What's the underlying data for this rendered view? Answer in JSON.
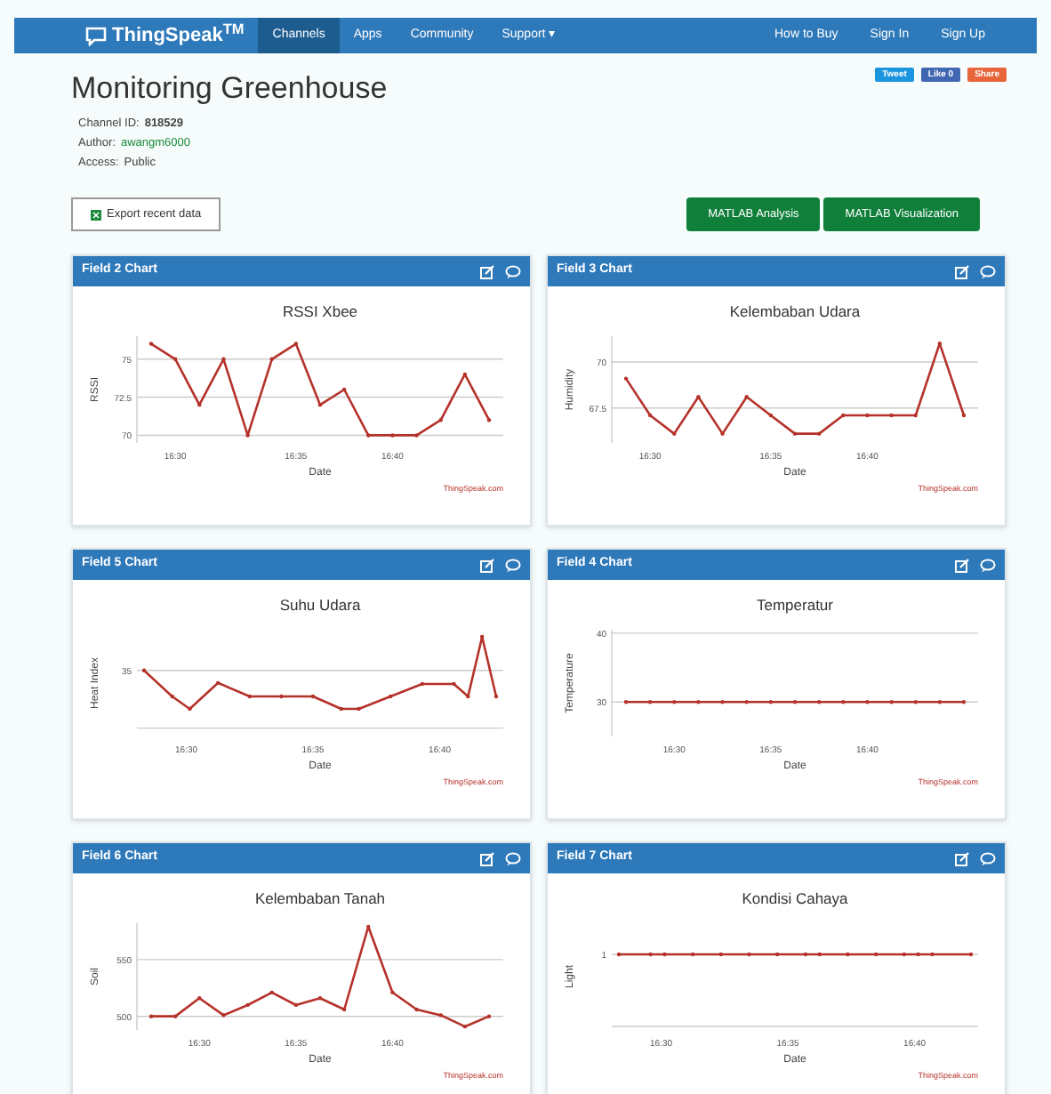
{
  "navbar": {
    "logo": "ThingSpeak$^{TM}$",
    "items": [
      {
        "label": "Channels",
        "selected": true
      },
      {
        "label": "Apps",
        "selected": false
      },
      {
        "label": "Community",
        "selected": false
      },
      {
        "label": "Support ▾",
        "selected": false
      }
    ],
    "right_items": [
      "How to Buy",
      "Sign In",
      "Sign Up"
    ]
  },
  "social": [
    {
      "kind": "tweet",
      "label": "Tweet"
    },
    {
      "kind": "like",
      "label": "Like 0"
    },
    {
      "kind": "share",
      "label": "Share"
    }
  ],
  "title": "Monitoring Greenhouse",
  "meta": [
    {
      "label": "Channel ID:",
      "value": "818529",
      "kind": "bold"
    },
    {
      "label": "Author:",
      "value": "awangm6000",
      "kind": "link"
    },
    {
      "label": "Access:",
      "value": "Public",
      "kind": "plain"
    }
  ],
  "export_button": "Export recent data",
  "matlab_buttons": [
    "MATLAB Analysis",
    "MATLAB Visualization"
  ],
  "panels": [
    {
      "header": "Field 2 Chart",
      "kind": "chart",
      "credit": "ThingSpeak.com",
      "chart_data": {
        "type": "line",
        "title": "RSSI Xbee",
        "xlabel": "Date",
        "ylabel": "RSSI",
        "categories": [
          null,
          "16:30",
          null,
          null,
          null,
          null,
          "16:35",
          null,
          null,
          null,
          "16:40",
          null,
          null,
          null,
          null
        ],
        "series": [
          {
            "color": "#b5322a",
            "values": [
              76,
              75,
              72,
              75,
              70,
              75,
              76,
              72,
              73,
              70,
              70,
              70,
              71,
              74,
              71
            ]
          }
        ],
        "grid": true,
        "ylim": [
          69.5,
          76.5
        ],
        "yticks": [
          70,
          {
            "value": 72.5,
            "label": "72.5"
          },
          75
        ]
      }
    },
    {
      "header": "Field 3 Chart",
      "kind": "chart",
      "credit": "ThingSpeak.com",
      "chart_data": {
        "type": "line",
        "title": "Kelembaban Udara",
        "xlabel": "Date",
        "ylabel": "Humidity",
        "categories": [
          null,
          "16:30",
          null,
          null,
          null,
          null,
          "16:35",
          null,
          null,
          null,
          "16:40",
          null,
          null,
          null,
          null
        ],
        "series": [
          {
            "color": "#b5322a",
            "values": [
              69.1,
              67.1,
              66.1,
              68.1,
              66.1,
              68.1,
              67.1,
              66.1,
              66.1,
              67.1,
              67.1,
              67.1,
              67.1,
              71.0,
              67.1
            ]
          }
        ],
        "grid": true,
        "ylim": [
          65.6,
          71.4
        ],
        "yticks": [
          {
            "value": 67.5,
            "label": "67.5"
          },
          70
        ]
      }
    },
    {
      "header": "Field 5 Chart",
      "kind": "picture",
      "credit": "ThingSpeak.com",
      "plot": {
        "title": "Suhu Udara",
        "xlabel": "Date",
        "ylabel": "Heat Index",
        "ytick_labels": [
          "35"
        ],
        "xtick_labels": [
          "16:30",
          "16:35",
          "16:40"
        ]
      }
    },
    {
      "header": "Field 4 Chart",
      "kind": "chart",
      "credit": "ThingSpeak.com",
      "chart_data": {
        "type": "line",
        "title": "Temperatur",
        "xlabel": "Date",
        "ylabel": "Temperature",
        "categories": [
          null,
          null,
          "16:30",
          null,
          null,
          null,
          "16:35",
          null,
          null,
          null,
          "16:40",
          null,
          null,
          null,
          null
        ],
        "series": [
          {
            "color": "#b5322a",
            "values": [
              30,
              30,
              30,
              30,
              30,
              30,
              30,
              30,
              30,
              30,
              30,
              30,
              30,
              30,
              30
            ]
          }
        ],
        "grid": true,
        "ylim": [
          25,
          40.5
        ],
        "yticks": [
          30,
          40
        ]
      }
    },
    {
      "header": "Field 6 Chart",
      "kind": "chart",
      "credit": "ThingSpeak.com",
      "chart_data": {
        "type": "line",
        "title": "Kelembaban Tanah",
        "xlabel": "Date",
        "ylabel": "Soil",
        "categories": [
          null,
          null,
          "16:30",
          null,
          null,
          null,
          "16:35",
          null,
          null,
          null,
          "16:40",
          null,
          null,
          null,
          null
        ],
        "series": [
          {
            "color": "#b5322a",
            "values": [
              500,
              500,
              516,
              501,
              510,
              521,
              510,
              516,
              506,
              579,
              521,
              506,
              501,
              491,
              500
            ]
          }
        ],
        "grid": true,
        "ylim": [
          488,
          582
        ],
        "yticks": [
          500,
          550
        ]
      }
    },
    {
      "header": "Field 7 Chart",
      "kind": "picture",
      "credit": "ThingSpeak.com",
      "plot": {
        "title": "Kondisi Cahaya",
        "xlabel": "Date",
        "ylabel": "Light",
        "ytick_labels": [
          "1"
        ],
        "xtick_labels": [
          "16:30",
          "16:35",
          "16:40"
        ]
      }
    }
  ]
}
